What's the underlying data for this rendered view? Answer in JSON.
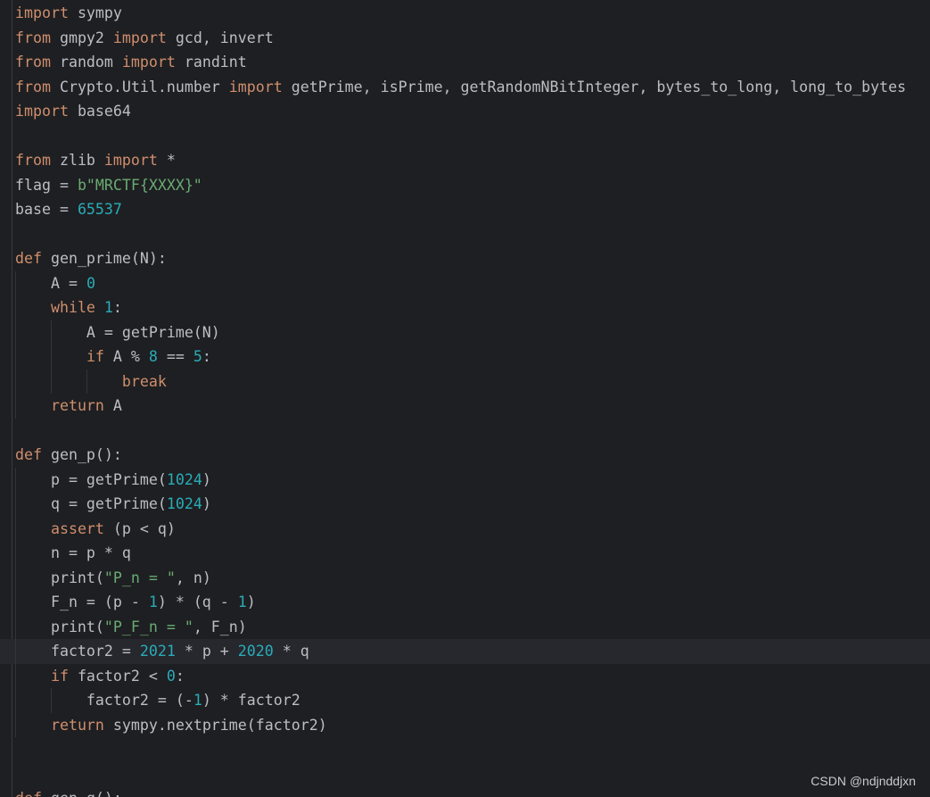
{
  "editor": {
    "language": "python",
    "theme_colors": {
      "background": "#1e1f22",
      "current_line": "#26282e",
      "keyword": "#cf8e6d",
      "number": "#2aacb8",
      "string": "#6aab73",
      "text": "#bcbec4"
    },
    "current_line_index": 26,
    "lines": [
      [
        {
          "t": "kw",
          "s": "import"
        },
        {
          "t": "text",
          "s": " sympy"
        }
      ],
      [
        {
          "t": "kw",
          "s": "from"
        },
        {
          "t": "text",
          "s": " gmpy2 "
        },
        {
          "t": "kw",
          "s": "import"
        },
        {
          "t": "text",
          "s": " gcd, invert"
        }
      ],
      [
        {
          "t": "kw",
          "s": "from"
        },
        {
          "t": "text",
          "s": " random "
        },
        {
          "t": "kw",
          "s": "import"
        },
        {
          "t": "text",
          "s": " randint"
        }
      ],
      [
        {
          "t": "kw",
          "s": "from"
        },
        {
          "t": "text",
          "s": " Crypto.Util.number "
        },
        {
          "t": "kw",
          "s": "import"
        },
        {
          "t": "text",
          "s": " getPrime, isPrime, getRandomNBitInteger, bytes_to_long, long_to_bytes"
        }
      ],
      [
        {
          "t": "kw",
          "s": "import"
        },
        {
          "t": "text",
          "s": " base64"
        }
      ],
      [],
      [
        {
          "t": "kw",
          "s": "from"
        },
        {
          "t": "text",
          "s": " zlib "
        },
        {
          "t": "kw",
          "s": "import"
        },
        {
          "t": "text",
          "s": " *"
        }
      ],
      [
        {
          "t": "text",
          "s": "flag = "
        },
        {
          "t": "str",
          "s": "b\"MRCTF{XXXX}\""
        }
      ],
      [
        {
          "t": "text",
          "s": "base = "
        },
        {
          "t": "num",
          "s": "65537"
        }
      ],
      [],
      [
        {
          "t": "kw",
          "s": "def"
        },
        {
          "t": "text",
          "s": " gen_prime(N):"
        }
      ],
      [
        {
          "t": "text",
          "s": "    A = "
        },
        {
          "t": "num",
          "s": "0"
        }
      ],
      [
        {
          "t": "text",
          "s": "    "
        },
        {
          "t": "kw",
          "s": "while"
        },
        {
          "t": "text",
          "s": " "
        },
        {
          "t": "num",
          "s": "1"
        },
        {
          "t": "text",
          "s": ":"
        }
      ],
      [
        {
          "t": "text",
          "s": "        A = getPrime(N)"
        }
      ],
      [
        {
          "t": "text",
          "s": "        "
        },
        {
          "t": "kw",
          "s": "if"
        },
        {
          "t": "text",
          "s": " A % "
        },
        {
          "t": "num",
          "s": "8"
        },
        {
          "t": "text",
          "s": " == "
        },
        {
          "t": "num",
          "s": "5"
        },
        {
          "t": "text",
          "s": ":"
        }
      ],
      [
        {
          "t": "text",
          "s": "            "
        },
        {
          "t": "kw",
          "s": "break"
        }
      ],
      [
        {
          "t": "text",
          "s": "    "
        },
        {
          "t": "kw",
          "s": "return"
        },
        {
          "t": "text",
          "s": " A"
        }
      ],
      [],
      [
        {
          "t": "kw",
          "s": "def"
        },
        {
          "t": "text",
          "s": " gen_p():"
        }
      ],
      [
        {
          "t": "text",
          "s": "    p = getPrime("
        },
        {
          "t": "num",
          "s": "1024"
        },
        {
          "t": "text",
          "s": ")"
        }
      ],
      [
        {
          "t": "text",
          "s": "    q = getPrime("
        },
        {
          "t": "num",
          "s": "1024"
        },
        {
          "t": "text",
          "s": ")"
        }
      ],
      [
        {
          "t": "text",
          "s": "    "
        },
        {
          "t": "kw",
          "s": "assert"
        },
        {
          "t": "text",
          "s": " (p < q)"
        }
      ],
      [
        {
          "t": "text",
          "s": "    n = p * q"
        }
      ],
      [
        {
          "t": "text",
          "s": "    print("
        },
        {
          "t": "str",
          "s": "\"P_n = \""
        },
        {
          "t": "text",
          "s": ", n)"
        }
      ],
      [
        {
          "t": "text",
          "s": "    F_n = (p - "
        },
        {
          "t": "num",
          "s": "1"
        },
        {
          "t": "text",
          "s": ") * (q - "
        },
        {
          "t": "num",
          "s": "1"
        },
        {
          "t": "text",
          "s": ")"
        }
      ],
      [
        {
          "t": "text",
          "s": "    print("
        },
        {
          "t": "str",
          "s": "\"P_F_n = \""
        },
        {
          "t": "text",
          "s": ", F_n)"
        }
      ],
      [
        {
          "t": "text",
          "s": "    factor2 = "
        },
        {
          "t": "num",
          "s": "2021"
        },
        {
          "t": "text",
          "s": " * p + "
        },
        {
          "t": "num",
          "s": "2020"
        },
        {
          "t": "text",
          "s": " * q"
        }
      ],
      [
        {
          "t": "text",
          "s": "    "
        },
        {
          "t": "kw",
          "s": "if"
        },
        {
          "t": "text",
          "s": " factor2 < "
        },
        {
          "t": "num",
          "s": "0"
        },
        {
          "t": "text",
          "s": ":"
        }
      ],
      [
        {
          "t": "text",
          "s": "        factor2 = (-"
        },
        {
          "t": "num",
          "s": "1"
        },
        {
          "t": "text",
          "s": ") * factor2"
        }
      ],
      [
        {
          "t": "text",
          "s": "    "
        },
        {
          "t": "kw",
          "s": "return"
        },
        {
          "t": "text",
          "s": " sympy.nextprime(factor2)"
        }
      ],
      [],
      [],
      [
        {
          "t": "kw",
          "s": "def"
        },
        {
          "t": "text",
          "s": " gen_q():"
        }
      ]
    ]
  },
  "watermark": {
    "text": "CSDN @ndjnddjxn"
  }
}
